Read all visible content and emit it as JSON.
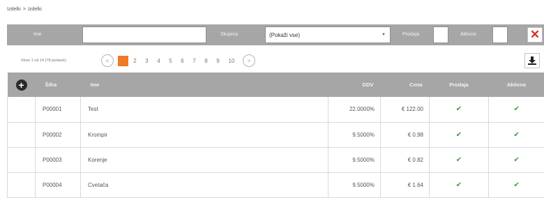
{
  "breadcrumb": [
    "Izdelki",
    ">",
    "Izdelki"
  ],
  "filters": {
    "name_label": "Ime",
    "name_value": "",
    "group_label": "Skupina",
    "group_value": "(Pokaži vse)",
    "sale_label": "Prodaja",
    "active_label": "Aktivno"
  },
  "pager": {
    "info": "Stran 1 od 14 (78 postavk)",
    "prev": "<",
    "next": ">",
    "pages": [
      "1",
      "2",
      "3",
      "4",
      "5",
      "6",
      "7",
      "8",
      "9",
      "10"
    ],
    "active_page": "1"
  },
  "table": {
    "columns": [
      "Šifra",
      "Ime",
      "DDV",
      "Cena",
      "Prodaja",
      "Aktivno"
    ],
    "rows": [
      {
        "code": "P00001",
        "name": "Test",
        "ddv": "22.0000%",
        "price": "€ 122.00",
        "sale": "✔",
        "active": "✔"
      },
      {
        "code": "P00002",
        "name": "Krompir",
        "ddv": "9.5000%",
        "price": "€ 0.98",
        "sale": "✔",
        "active": "✔"
      },
      {
        "code": "P00003",
        "name": "Korenje",
        "ddv": "9.5000%",
        "price": "€ 0.82",
        "sale": "✔",
        "active": "✔"
      },
      {
        "code": "P00004",
        "name": "Cvetača",
        "ddv": "9.5000%",
        "price": "€ 1.64",
        "sale": "✔",
        "active": "✔"
      }
    ]
  },
  "colors": {
    "header_gray": "#a6a6a6",
    "active_page": "#f07a26",
    "check_green": "#3b9a3b",
    "close_red": "#d93025"
  },
  "icons": {
    "add": "plus-circle-icon",
    "download": "download-icon",
    "close": "close-icon",
    "check": "check-icon"
  }
}
